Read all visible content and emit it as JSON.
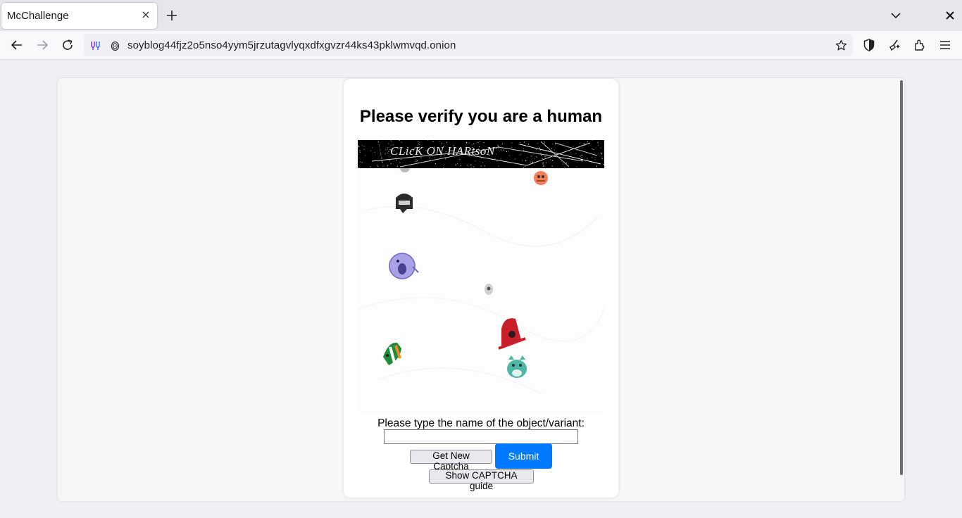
{
  "browser": {
    "tab": {
      "title": "McChallenge"
    },
    "url": "soyblog44fjz2o5nso4yym5jrzutagvlyqxdfxgvzr44ks43pklwmvqd.onion"
  },
  "captcha": {
    "heading": "Please verify you are a human",
    "challenge_text": "CLicK ON HARtsoN",
    "objects": [
      {
        "icon": "grey-sticker-icon",
        "color": "#d8d8d8"
      },
      {
        "icon": "orange-face-icon",
        "color": "#f08058"
      },
      {
        "icon": "black-helmet-icon",
        "color": "#2b2b2b"
      },
      {
        "icon": "purple-blob-icon",
        "color": "#a9a2e6"
      },
      {
        "icon": "small-grey-figure-icon",
        "color": "#9a9a9a"
      },
      {
        "icon": "red-hat-icon",
        "color": "#c8202a"
      },
      {
        "icon": "irish-flag-face-icon",
        "color": "#1e8c3a"
      },
      {
        "icon": "teal-face-icon",
        "color": "#4bb7a4"
      }
    ],
    "prompt": "Please type the name of the object/variant:",
    "input_value": "",
    "get_new_label": "Get New Captcha",
    "submit_label": "Submit",
    "guide_label": "Show CAPTCHA guide",
    "submit_color": "#007bff"
  }
}
